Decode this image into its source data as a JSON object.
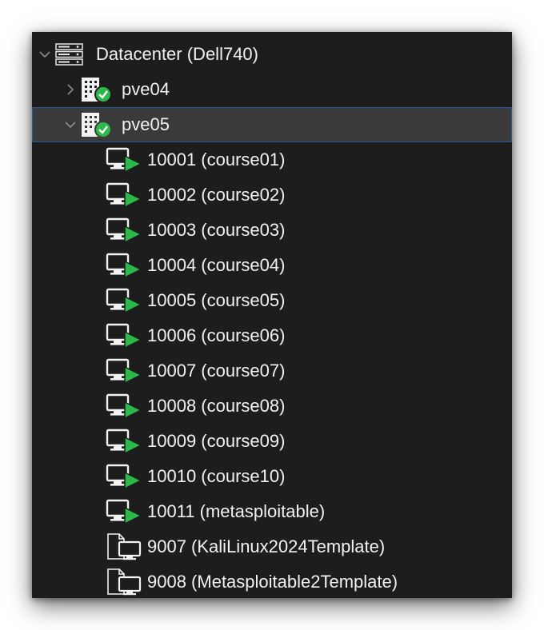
{
  "tree": {
    "datacenter": {
      "label": "Datacenter (Dell740)",
      "icon": "server-rack-icon",
      "expanded": true
    },
    "nodes": [
      {
        "label": "pve04",
        "icon": "node-online-icon",
        "status_icon": "check-circle-icon",
        "expanded": false,
        "selected": false
      },
      {
        "label": "pve05",
        "icon": "node-online-icon",
        "status_icon": "check-circle-icon",
        "expanded": true,
        "selected": true
      }
    ],
    "vms": [
      {
        "label": "10001 (course01)",
        "icon": "vm-running-icon"
      },
      {
        "label": "10002 (course02)",
        "icon": "vm-running-icon"
      },
      {
        "label": "10003 (course03)",
        "icon": "vm-running-icon"
      },
      {
        "label": "10004 (course04)",
        "icon": "vm-running-icon"
      },
      {
        "label": "10005 (course05)",
        "icon": "vm-running-icon"
      },
      {
        "label": "10006 (course06)",
        "icon": "vm-running-icon"
      },
      {
        "label": "10007 (course07)",
        "icon": "vm-running-icon"
      },
      {
        "label": "10008 (course08)",
        "icon": "vm-running-icon"
      },
      {
        "label": "10009 (course09)",
        "icon": "vm-running-icon"
      },
      {
        "label": "10010 (course10)",
        "icon": "vm-running-icon"
      },
      {
        "label": "10011 (metasploitable)",
        "icon": "vm-running-icon"
      }
    ],
    "templates": [
      {
        "label": "9007 (KaliLinux2024Template)",
        "icon": "vm-template-icon"
      },
      {
        "label": "9008 (Metasploitable2Template)",
        "icon": "vm-template-icon"
      }
    ]
  },
  "colors": {
    "panel_bg": "#1d1d1d",
    "selected_bg": "#3a3a3a",
    "selected_border": "#2a5aa0",
    "running_green": "#2db84a",
    "text": "#f2f2f2"
  }
}
